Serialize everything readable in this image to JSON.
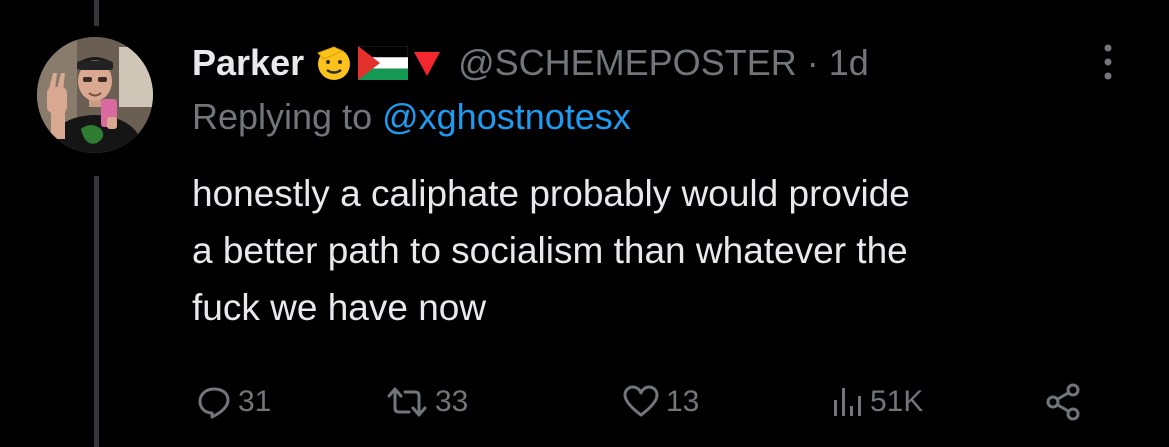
{
  "tweet": {
    "author_name": "Parker",
    "handle_time": "@SCHEMEPOSTER · 1d",
    "replying_prefix": "Replying to ",
    "replying_to": "@xghostnotesx",
    "text": "honestly a caliphate probably would provide\na better path to socialism than whatever the\nfuck we have now"
  },
  "emojis": [
    "saluting-face-emoji",
    "palestine-flag-emoji",
    "red-triangle-down-emoji"
  ],
  "actions": {
    "replies": "31",
    "retweets": "33",
    "likes": "13",
    "views": "51K"
  },
  "colors": {
    "background": "#000000",
    "text": "#e7e9ea",
    "muted": "#71767b",
    "link": "#1d9bf0",
    "thread_line": "#333639"
  }
}
